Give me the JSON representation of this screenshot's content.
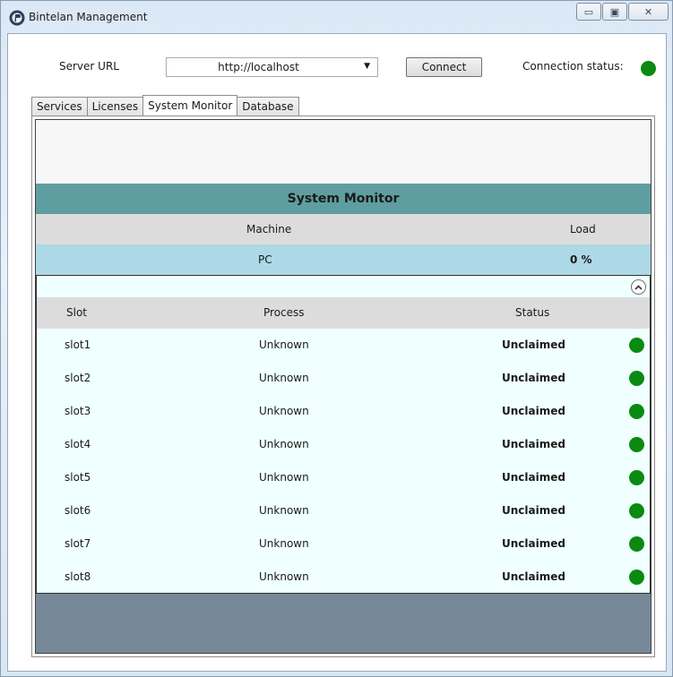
{
  "window": {
    "title": "Bintelan Management",
    "controls": {
      "minimize": "▭",
      "maximize": "▣",
      "close": "✕"
    }
  },
  "toolbar": {
    "server_url_label": "Server URL",
    "server_url_value": "http://localhost",
    "connect_label": "Connect",
    "connection_status_label": "Connection status:",
    "connection_status_color": "#0a8a10"
  },
  "tabs": [
    {
      "label": "Services",
      "active": false
    },
    {
      "label": "Licenses",
      "active": false
    },
    {
      "label": "System Monitor",
      "active": true
    },
    {
      "label": "Database",
      "active": false
    }
  ],
  "monitor": {
    "title": "System Monitor",
    "machine_header": "Machine",
    "load_header": "Load",
    "machine": "PC",
    "load": "0 %",
    "slot_columns": {
      "slot": "Slot",
      "process": "Process",
      "status": "Status"
    },
    "slots": [
      {
        "slot": "slot1",
        "process": "Unknown",
        "status": "Unclaimed"
      },
      {
        "slot": "slot2",
        "process": "Unknown",
        "status": "Unclaimed"
      },
      {
        "slot": "slot3",
        "process": "Unknown",
        "status": "Unclaimed"
      },
      {
        "slot": "slot4",
        "process": "Unknown",
        "status": "Unclaimed"
      },
      {
        "slot": "slot5",
        "process": "Unknown",
        "status": "Unclaimed"
      },
      {
        "slot": "slot6",
        "process": "Unknown",
        "status": "Unclaimed"
      },
      {
        "slot": "slot7",
        "process": "Unknown",
        "status": "Unclaimed"
      },
      {
        "slot": "slot8",
        "process": "Unknown",
        "status": "Unclaimed"
      }
    ]
  },
  "colors": {
    "header_band": "#5f9ea0",
    "machine_row": "#add8e6",
    "details_bg": "#f0ffff",
    "footer_band": "#778899",
    "status_ok": "#0a8a10"
  }
}
